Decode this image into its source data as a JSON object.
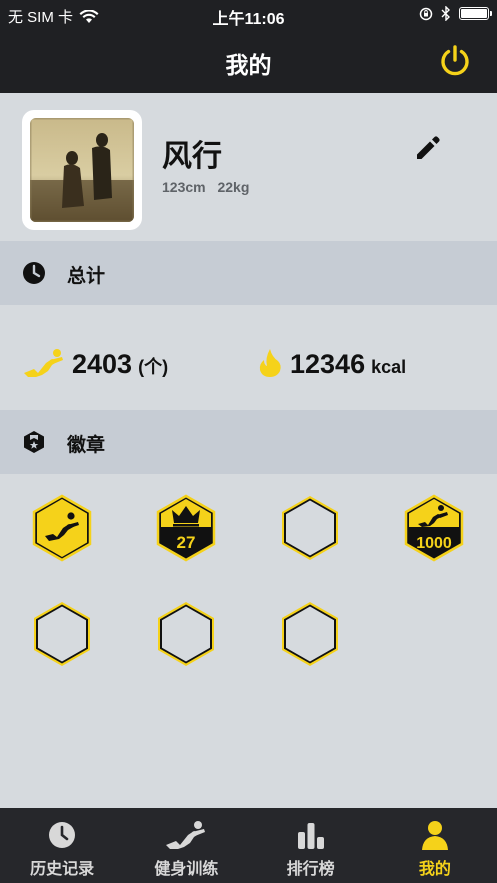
{
  "status_bar": {
    "carrier": "无 SIM 卡",
    "time": "上午11:06",
    "battery_level": 1.0
  },
  "nav": {
    "title": "我的",
    "power_icon": "power-icon"
  },
  "profile": {
    "name": "风行",
    "height": "123cm",
    "weight": "22kg",
    "edit_icon": "pencil-icon"
  },
  "sections": {
    "totals_label": "总计",
    "badges_label": "徽章"
  },
  "totals": {
    "count_value": "2403",
    "count_unit": "(个)",
    "calorie_value": "12346",
    "calorie_unit": "kcal"
  },
  "badges": [
    {
      "state": "unlocked",
      "icon": "situp-badge-icon",
      "text": ""
    },
    {
      "state": "unlocked",
      "icon": "crown-badge-icon",
      "text": "27"
    },
    {
      "state": "locked",
      "icon": "empty-badge-icon",
      "text": ""
    },
    {
      "state": "unlocked",
      "icon": "situp-1000-badge-icon",
      "text": "1000"
    },
    {
      "state": "locked",
      "icon": "empty-badge-icon",
      "text": ""
    },
    {
      "state": "locked",
      "icon": "empty-badge-icon",
      "text": ""
    },
    {
      "state": "locked",
      "icon": "empty-badge-icon",
      "text": ""
    }
  ],
  "tabs": [
    {
      "label": "历史记录",
      "icon": "clock-icon",
      "active": false
    },
    {
      "label": "健身训练",
      "icon": "situp-icon",
      "active": false
    },
    {
      "label": "排行榜",
      "icon": "bar-chart-icon",
      "active": false
    },
    {
      "label": "我的",
      "icon": "person-icon",
      "active": true
    }
  ],
  "colors": {
    "accent": "#f5d21a",
    "navbar": "#1f2023",
    "background": "#d6dade",
    "section_header": "#c6ccd4",
    "tabbar": "#26272b"
  }
}
